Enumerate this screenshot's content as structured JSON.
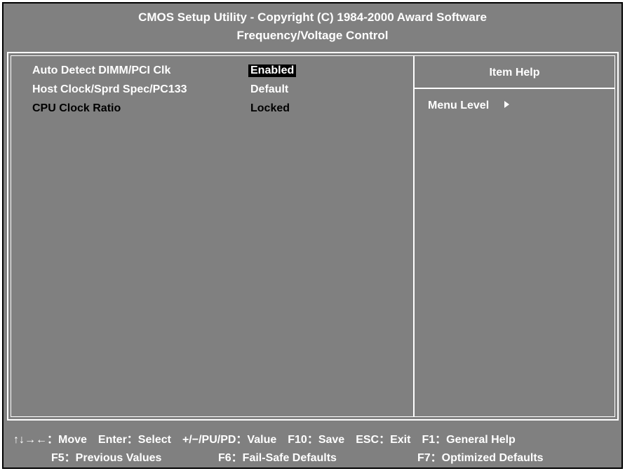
{
  "header": {
    "title": "CMOS Setup Utility - Copyright (C) 1984-2000 Award Software",
    "subtitle": "Frequency/Voltage Control"
  },
  "settings": [
    {
      "label": "Auto Detect DIMM/PCI Clk",
      "value": "Enabled",
      "selected": true
    },
    {
      "label": "Host Clock/Sprd Spec/PC133",
      "value": "Default",
      "selected": false
    },
    {
      "label": "CPU Clock Ratio",
      "value": "Locked",
      "selected": false
    }
  ],
  "help_panel": {
    "title": "Item Help",
    "menu_level_label": "Menu Level",
    "menu_level_icon": "triangle-right-icon"
  },
  "footer": {
    "move": "↑↓→←：Move",
    "enter": "Enter：Select",
    "value": "+/−/PU/PD：Value",
    "save": "F10：Save",
    "esc": "ESC：Exit",
    "help": "F1：General Help",
    "previous": "F5：Previous Values",
    "failsafe": "F6：Fail-Safe Defaults",
    "optimized": "F7：Optimized Defaults"
  },
  "colors": {
    "background": "#808080",
    "text": "#ffffff",
    "highlight_bg": "#000000",
    "dim_text": "#000000"
  }
}
